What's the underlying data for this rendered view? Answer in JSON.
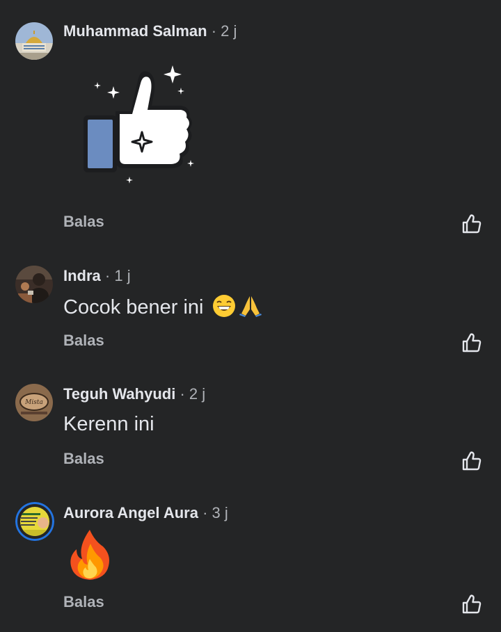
{
  "comments": [
    {
      "author": "Muhammad Salman",
      "time": " · 2 j",
      "content_type": "sticker",
      "sticker": "thumbs-up-sparkle",
      "reply_label": "Balas",
      "avatar": "mosque-dome-avatar"
    },
    {
      "author": "Indra",
      "time": " · 1 j",
      "text": "Cocok bener ini",
      "emojis": [
        "grinning-face",
        "folded-hands"
      ],
      "reply_label": "Balas",
      "avatar": "person-photo-avatar"
    },
    {
      "author": "Teguh Wahyudi",
      "time": " · 2 j",
      "text": "Kerenn ini",
      "reply_label": "Balas",
      "avatar": "logo-badge-avatar"
    },
    {
      "author": "Aurora Angel Aura",
      "time": " · 3 j",
      "content_type": "emoji",
      "emoji": "fire",
      "reply_label": "Balas",
      "avatar": "yellow-banner-avatar"
    }
  ],
  "colors": {
    "background": "#242526",
    "primary_text": "#e4e6eb",
    "secondary_text": "#b0b3b8",
    "story_ring": "#2374e1"
  }
}
